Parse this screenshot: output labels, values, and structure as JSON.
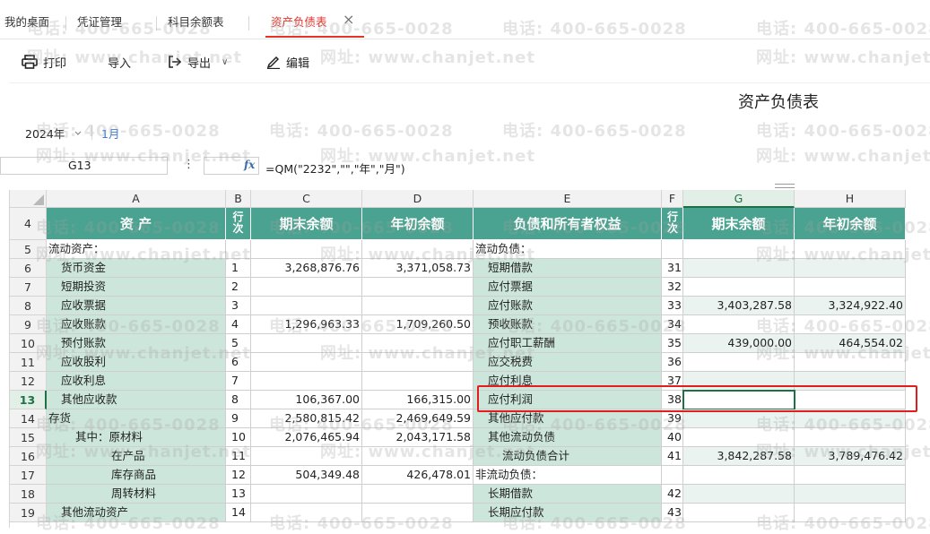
{
  "tabs": [
    {
      "label": "我的桌面"
    },
    {
      "label": "凭证管理"
    },
    {
      "label": "科目余额表"
    },
    {
      "label": "资产负债表",
      "active": true
    }
  ],
  "tab_close": "×",
  "toolbar": {
    "print_label": "打印",
    "import_label": "导入",
    "export_label": "导出",
    "export_caret": "∨",
    "edit_label": "编辑"
  },
  "report": {
    "title": "资产负债表",
    "year": "2024年",
    "month": "1月"
  },
  "formula_bar": {
    "cell_ref": "G13",
    "dots": "⋮",
    "fx": "fx",
    "formula": "=QM(\"2232\",\"\",\"年\",\"月\")"
  },
  "watermark": {
    "phone": "电话: 400-665-0028",
    "site": "网址: www.chanjet.net"
  },
  "columns": [
    "A",
    "B",
    "C",
    "D",
    "E",
    "F",
    "G",
    "H"
  ],
  "header_row": {
    "row_no": "4",
    "A": "资    产",
    "B": "行次",
    "C": "期末余额",
    "D": "年初余额",
    "E": "负债和所有者权益",
    "F": "行次",
    "G": "期末余额",
    "H": "年初余额"
  },
  "rows": [
    {
      "no": "5",
      "A": "流动资产：",
      "B": "",
      "C": "",
      "D": "",
      "E": "流动负债：",
      "F": "",
      "G": "",
      "H": ""
    },
    {
      "no": "6",
      "A": "货币资金",
      "B": "1",
      "C": "3,268,876.76",
      "D": "3,371,058.73",
      "E": "短期借款",
      "F": "31",
      "G": "",
      "H": ""
    },
    {
      "no": "7",
      "A": "短期投资",
      "B": "2",
      "C": "",
      "D": "",
      "E": "应付票据",
      "F": "32",
      "G": "",
      "H": ""
    },
    {
      "no": "8",
      "A": "应收票据",
      "B": "3",
      "C": "",
      "D": "",
      "E": "应付账款",
      "F": "33",
      "G": "3,403,287.58",
      "H": "3,324,922.40"
    },
    {
      "no": "9",
      "A": "应收账款",
      "B": "4",
      "C": "1,296,963.33",
      "D": "1,709,260.50",
      "E": "预收账款",
      "F": "34",
      "G": "",
      "H": ""
    },
    {
      "no": "10",
      "A": "预付账款",
      "B": "5",
      "C": "",
      "D": "",
      "E": "应付职工薪酬",
      "F": "35",
      "G": "439,000.00",
      "H": "464,554.02"
    },
    {
      "no": "11",
      "A": "应收股利",
      "B": "6",
      "C": "",
      "D": "",
      "E": "应交税费",
      "F": "36",
      "G": "",
      "H": ""
    },
    {
      "no": "12",
      "A": "应收利息",
      "B": "7",
      "C": "",
      "D": "",
      "E": "应付利息",
      "F": "37",
      "G": "",
      "H": ""
    },
    {
      "no": "13",
      "A": "其他应收款",
      "B": "8",
      "C": "106,367.00",
      "D": "166,315.00",
      "E": "应付利润",
      "F": "38",
      "G": "",
      "H": ""
    },
    {
      "no": "14",
      "A": "存货",
      "B": "9",
      "C": "2,580,815.42",
      "D": "2,469,649.59",
      "E": "其他应付款",
      "F": "39",
      "G": "",
      "H": ""
    },
    {
      "no": "15",
      "A": "其中：原材料",
      "B": "10",
      "C": "2,076,465.94",
      "D": "2,043,171.58",
      "E": "其他流动负债",
      "F": "40",
      "G": "",
      "H": ""
    },
    {
      "no": "16",
      "A": "在产品",
      "B": "11",
      "C": "",
      "D": "",
      "E": "流动负债合计",
      "F": "41",
      "G": "3,842,287.58",
      "H": "3,789,476.42"
    },
    {
      "no": "17",
      "A": "库存商品",
      "B": "12",
      "C": "504,349.48",
      "D": "426,478.01",
      "E": "非流动负债：",
      "F": "",
      "G": "",
      "H": ""
    },
    {
      "no": "18",
      "A": "周转材料",
      "B": "13",
      "C": "",
      "D": "",
      "E": "长期借款",
      "F": "42",
      "G": "",
      "H": ""
    },
    {
      "no": "19",
      "A": "其他流动资产",
      "B": "14",
      "C": "",
      "D": "",
      "E": "长期应付款",
      "F": "43",
      "G": "",
      "H": ""
    }
  ],
  "colors": {
    "accent_red": "#e6332a",
    "header_teal": "#4aa391",
    "mint": "#cde6dc",
    "pale": "#eaf3f0",
    "selection_green": "#1e7145",
    "highlight_box": "#e11d1d"
  }
}
